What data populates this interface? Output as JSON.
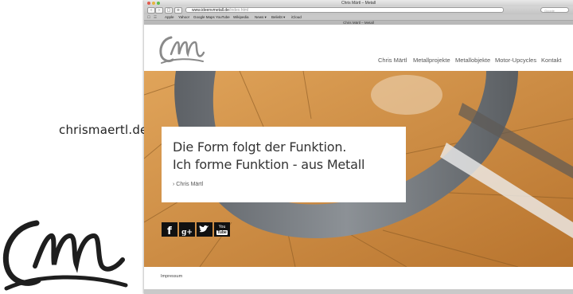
{
  "promo": {
    "domain": "chrismaertl.de"
  },
  "browser": {
    "window_title": "Chris Märtl – Metall",
    "url_host": "www.ideenvmetall.de",
    "url_path": "/index.html",
    "search_placeholder": "Google",
    "bookmarks": [
      "Apple",
      "Yahoo!",
      "Google Maps",
      "YouTube",
      "Wikipedia",
      "News ▾",
      "Beliebt ▾",
      "iCloud"
    ],
    "tab_title": "Chris Märtl – Metall"
  },
  "site": {
    "nav": [
      "Chris Märtl",
      "Metallprojekte",
      "Metallobjekte",
      "Motor-Upcycles",
      "Kontakt"
    ],
    "tagline_line1": "Die Form folgt der Funktion.",
    "tagline_line2": "Ich forme Funktion - aus Metall",
    "author_link": "Chris Märtl",
    "social": {
      "facebook": "f",
      "googleplus": "g+",
      "youtube_top": "You",
      "youtube_bottom": "Tube"
    },
    "footer_link": "Impressum"
  },
  "colors": {
    "wood": "#c98a3e",
    "steel": "#6e7378",
    "text": "#333333"
  }
}
